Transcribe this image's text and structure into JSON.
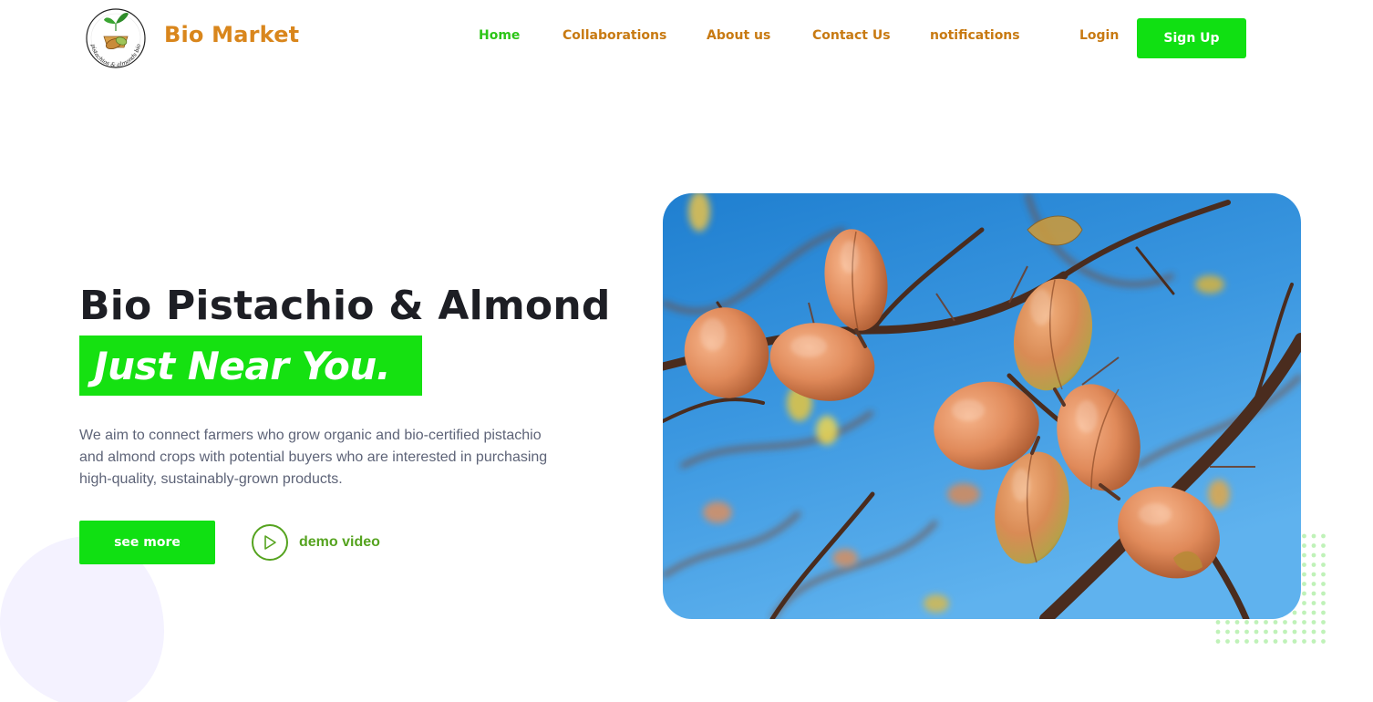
{
  "brand": {
    "name": "Bio Market",
    "logo_text": "pistachios & almonds bio"
  },
  "nav": {
    "items": [
      {
        "label": "Home",
        "active": true
      },
      {
        "label": "Collaborations",
        "active": false
      },
      {
        "label": "About us",
        "active": false
      },
      {
        "label": "Contact Us",
        "active": false
      },
      {
        "label": "notifications",
        "active": false
      }
    ],
    "login_label": "Login",
    "signup_label": "Sign Up"
  },
  "hero": {
    "title": "Bio Pistachio & Almond",
    "highlight": "Just Near You.",
    "description": "We aim to connect farmers who grow organic and bio-certified pistachio and almond crops with potential buyers who are interested in purchasing high-quality, sustainably-grown products.",
    "see_more_label": "see more",
    "demo_label": "demo video",
    "image_subject": "almond fruits on a branch against a blue sky"
  },
  "colors": {
    "accent_green": "#10e012",
    "brand_orange": "#d9861c",
    "nav_orange": "#c87a12",
    "active_green": "#2cc517",
    "heading_dark": "#1d1e24",
    "body_gray": "#5e6478",
    "demo_green": "#55a31f",
    "sky_blue": "#3b97e0"
  }
}
